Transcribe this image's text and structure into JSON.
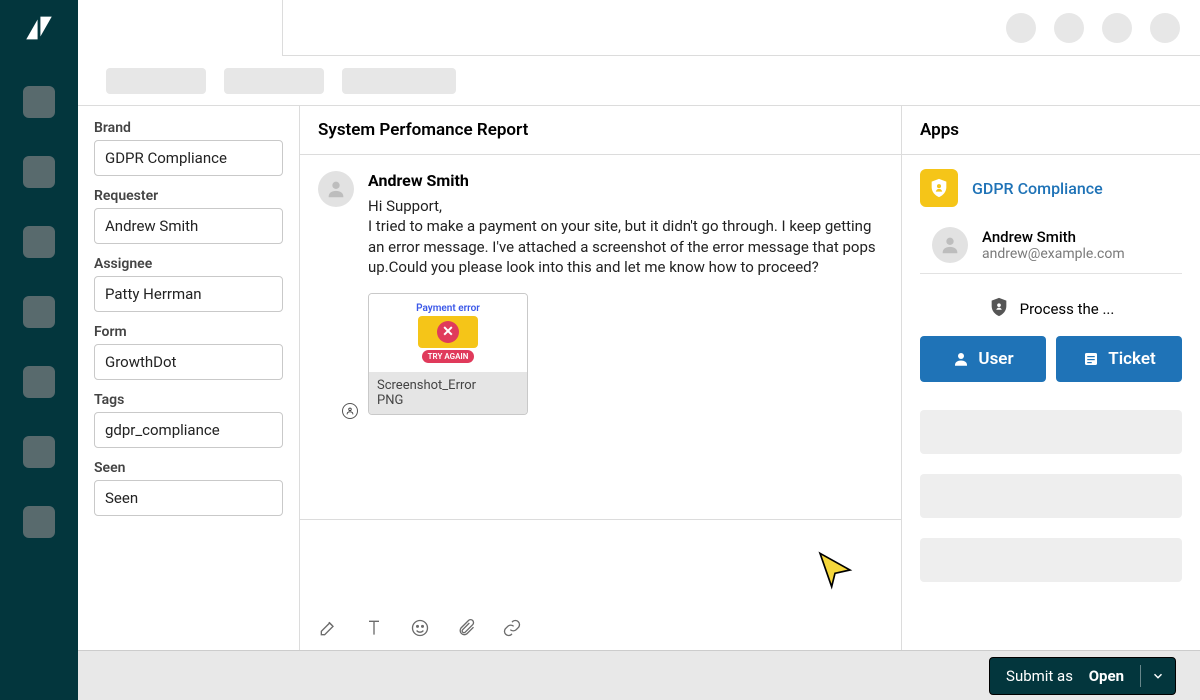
{
  "sidebar": {
    "brand": {
      "label": "Brand",
      "value": "GDPR Compliance"
    },
    "requester": {
      "label": "Requester",
      "value": "Andrew Smith"
    },
    "assignee": {
      "label": "Assignee",
      "value": "Patty Herrman"
    },
    "form": {
      "label": "Form",
      "value": "GrowthDot"
    },
    "tags": {
      "label": "Tags",
      "value": "gdpr_compliance"
    },
    "seen": {
      "label": "Seen",
      "value": "Seen"
    }
  },
  "thread": {
    "title": "System Perfomance Report",
    "author": "Andrew Smith",
    "body_line1": "Hi Support,",
    "body_rest": "I tried to make a payment on your site, but it didn't go through. I keep getting an error message. I've attached a screenshot of the error message that pops up.Could you please look into this and let me know how to proceed?",
    "attachment": {
      "preview_title": "Payment error",
      "preview_button": "TRY AGAIN",
      "filename": "Screenshot_Error",
      "filetype": "PNG"
    }
  },
  "apps": {
    "title": "Apps",
    "app_name": "GDPR Compliance",
    "user_name": "Andrew Smith",
    "user_email": "andrew@example.com",
    "process_label": "Process the ...",
    "btn_user": "User",
    "btn_ticket": "Ticket"
  },
  "footer": {
    "submit_prefix": "Submit as",
    "submit_status": "Open"
  }
}
